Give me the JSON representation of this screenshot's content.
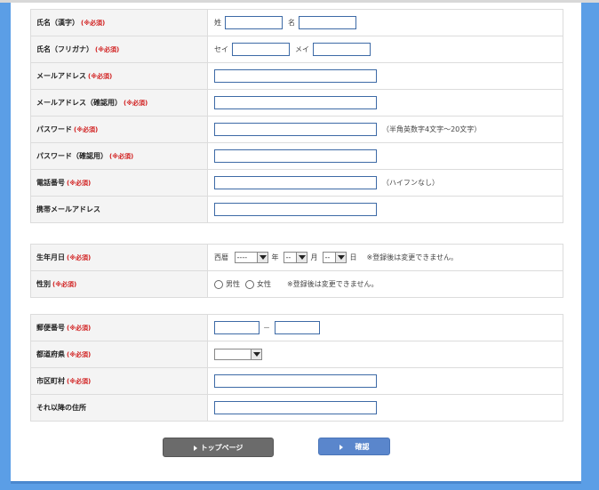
{
  "required_mark": "(※必須)",
  "section1": {
    "name_kanji": {
      "label": "氏名（漢字）",
      "sei_prefix": "姓",
      "mei_prefix": "名"
    },
    "name_furigana": {
      "label": "氏名（フリガナ）",
      "sei_prefix": "セイ",
      "mei_prefix": "メイ"
    },
    "email": {
      "label": "メールアドレス"
    },
    "email_confirm": {
      "label": "メールアドレス（確認用）"
    },
    "password": {
      "label": "パスワード",
      "note": "（半角英数字4文字～20文字）"
    },
    "password_confirm": {
      "label": "パスワード（確認用）"
    },
    "phone": {
      "label": "電話番号",
      "note": "（ハイフンなし）"
    },
    "mobile_email": {
      "label": "携帯メールアドレス"
    }
  },
  "section2": {
    "birthdate": {
      "label": "生年月日",
      "era_prefix": "西暦",
      "year_value": "----",
      "year_unit": "年",
      "month_value": "--",
      "month_unit": "月",
      "day_value": "--",
      "day_unit": "日",
      "note": "※登録後は変更できません。"
    },
    "gender": {
      "label": "性別",
      "male": "男性",
      "female": "女性",
      "note": "※登録後は変更できません。"
    }
  },
  "section3": {
    "zip": {
      "label": "郵便番号",
      "separator": "－"
    },
    "prefecture": {
      "label": "都道府県",
      "value": ""
    },
    "city": {
      "label": "市区町村"
    },
    "address_rest": {
      "label": "それ以降の住所"
    }
  },
  "buttons": {
    "top_page": "トップページ",
    "confirm": "確認"
  }
}
